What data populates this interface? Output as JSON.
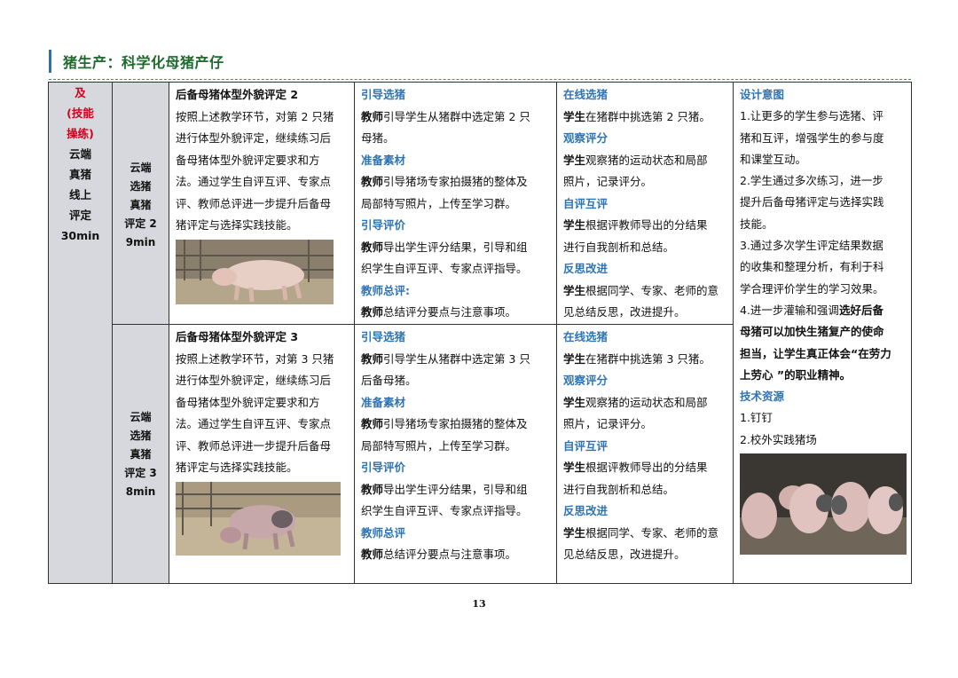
{
  "header": {
    "title": "猪生产：科学化母猪产仔"
  },
  "left_label": {
    "line1": "及",
    "line2": "(技能",
    "line3": "操练)",
    "line4": "云端",
    "line5": "真猪",
    "line6": "线上",
    "line7": "评定",
    "line8": "30min"
  },
  "rows": [
    {
      "sub_label": [
        "云端",
        "选猪",
        "真猪",
        "评定 2",
        "9min"
      ],
      "content_title": "后备母猪体型外貌评定 2",
      "content_lines": [
        "按照上述教学环节，对第 2 只猪",
        "进行体型外貌评定，继续练习后",
        "备母猪体型外貌评定要求和方",
        "法。通过学生自评互评、专家点",
        "评、教师总评进一步提升后备母",
        "猪评定与选择实践技能。"
      ],
      "teacher": {
        "h1": "引导选猪",
        "s1": "教师",
        "t1a": "引导学生从猪群中选定第 2 只",
        "t1b": "母猪。",
        "h2": "准备素材",
        "s2": "教师",
        "t2a": "引导猪场专家拍摄猪的整体及",
        "t2b": "局部特写照片，上传至学习群。",
        "h3": "引导评价",
        "s3": "教师",
        "t3a": "导出学生评分结果，引导和组",
        "t3b": "织学生自评互评、专家点评指导。",
        "h4": "教师总评:",
        "s4": "教师",
        "t4a": "总结评分要点与注意事项。"
      },
      "student": {
        "h1": "在线选猪",
        "s1": "学生",
        "t1a": "在猪群中挑选第 2 只猪。",
        "h2": "观察评分",
        "s2": "学生",
        "t2a": "观察猪的运动状态和局部",
        "t2b": "照片，记录评分。",
        "h3": "自评互评",
        "s3": "学生",
        "t3a": "根据评教师导出的分结果",
        "t3b": "进行自我剖析和总结。",
        "h4": "反思改进",
        "s4": "学生",
        "t4a": "根据同学、专家、老师的意",
        "t4b": "见总结反思，改进提升。"
      }
    },
    {
      "sub_label": [
        "云端",
        "选猪",
        "真猪",
        "评定 3",
        "8min"
      ],
      "content_title": "后备母猪体型外貌评定 3",
      "content_lines": [
        "按照上述教学环节，对第 3 只猪",
        "进行体型外貌评定，继续练习后",
        "备母猪体型外貌评定要求和方",
        "法。通过学生自评互评、专家点",
        "评、教师总评进一步提升后备母",
        "猪评定与选择实践技能。"
      ],
      "teacher": {
        "h1": "引导选猪",
        "s1": "教师",
        "t1a": "引导学生从猪群中选定第 3 只",
        "t1b": "后备母猪。",
        "h2": "准备素材",
        "s2": "教师",
        "t2a": "引导猪场专家拍摄猪的整体及",
        "t2b": "局部特写照片，上传至学习群。",
        "h3": "引导评价",
        "s3": "教师",
        "t3a": "导出学生评分结果，引导和组",
        "t3b": "织学生自评互评、专家点评指导。",
        "h4": "教师总评",
        "s4": "教师",
        "t4a": "总结评分要点与注意事项。"
      },
      "student": {
        "h1": "在线选猪",
        "s1": "学生",
        "t1a": "在猪群中挑选第 3 只猪。",
        "h2": "观察评分",
        "s2": "学生",
        "t2a": "观察猪的运动状态和局部",
        "t2b": "照片，记录评分。",
        "h3": "自评互评",
        "s3": "学生",
        "t3a": "根据评教师导出的分结果",
        "t3b": "进行自我剖析和总结。",
        "h4": "反思改进",
        "s4": "学生",
        "t4a": "根据同学、专家、老师的意",
        "t4b": "见总结反思，改进提升。"
      }
    }
  ],
  "design": {
    "heading": "设计意图",
    "lines": [
      "1.让更多的学生参与选猪、评",
      "猪和互评，增强学生的参与度",
      "和课堂互动。",
      "2.学生通过多次练习，进一步",
      "提升后备母猪评定与选择实践",
      "技能。",
      "3.通过多次学生评定结果数据",
      "的收集和整理分析，有利于科",
      "学合理评价学生的学习效果。"
    ],
    "line10_plain": "4.进一步灌输和强调",
    "line10_bold": "选好后备",
    "bold_lines": [
      "母猪可以加快生猪复产的使命",
      "担当，让学生真正体会“在劳力",
      "上劳心 ”的职业精神。"
    ],
    "tech_heading": "技术资源",
    "tech_items": [
      "1.钉钉",
      "2.校外实践猪场"
    ]
  },
  "page_number": "13",
  "colors": {
    "heading_blue": "#2e74b5",
    "title_green": "#1f6b2e",
    "label_red": "#d0021b",
    "label_bg": "#d6d8de"
  }
}
